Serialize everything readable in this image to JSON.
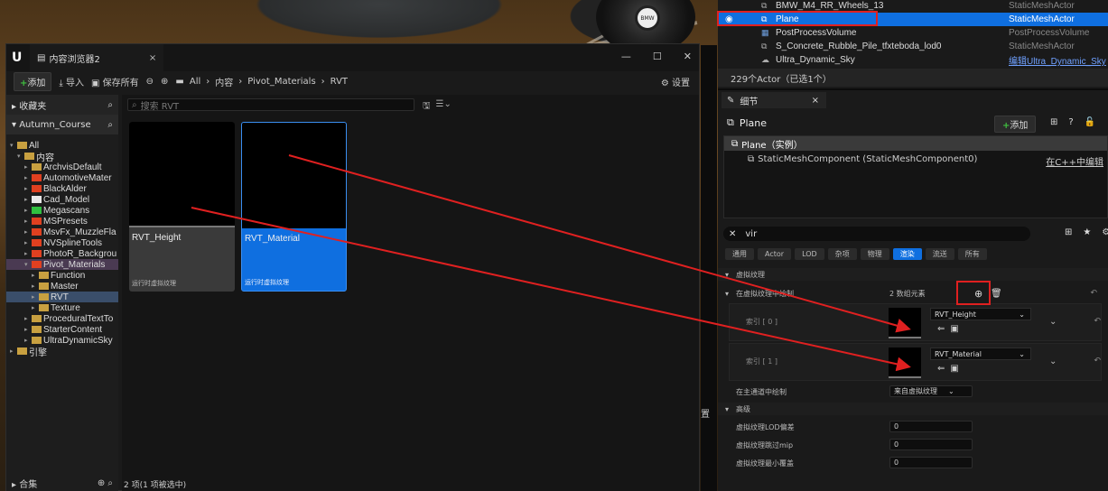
{
  "viewport": {
    "wheel_logo": "BMW"
  },
  "outliner": {
    "rows": [
      {
        "name": "BMW_M4_RR_Wheels_13",
        "type": "StaticMeshActor",
        "icon": "static-mesh-icon"
      },
      {
        "name": "Plane",
        "type": "StaticMeshActor",
        "icon": "static-mesh-icon",
        "selected": true
      },
      {
        "name": "PostProcessVolume",
        "type": "PostProcessVolume",
        "icon": "volume-icon"
      },
      {
        "name": "S_Concrete_Rubble_Pile_tfxteboda_lod0",
        "type": "StaticMeshActor",
        "icon": "static-mesh-icon"
      },
      {
        "name": "Ultra_Dynamic_Sky",
        "type": "编辑Ultra_Dynamic_Sky",
        "icon": "sky-icon"
      }
    ],
    "actor_count": "229个Actor（已选1个）"
  },
  "content_browser": {
    "tab_title": "内容浏览器2",
    "toolbar": {
      "add": "添加",
      "import": "导入",
      "save_all": "保存所有",
      "settings": "设置"
    },
    "breadcrumb": [
      "All",
      "内容",
      "Pivot_Materials",
      "RVT"
    ],
    "favorites": "收藏夹",
    "project": "Autumn_Course",
    "tree": [
      {
        "label": "All",
        "level": 0,
        "color": "#c8a040",
        "open": true
      },
      {
        "label": "内容",
        "level": 1,
        "color": "#c8a040",
        "open": true
      },
      {
        "label": "ArchvisDefault",
        "level": 2,
        "color": "#c8a040"
      },
      {
        "label": "AutomotiveMater",
        "level": 2,
        "color": "#e04020"
      },
      {
        "label": "BlackAlder",
        "level": 2,
        "color": "#e04020"
      },
      {
        "label": "Cad_Model",
        "level": 2,
        "color": "#e8e8e8"
      },
      {
        "label": "Megascans",
        "level": 2,
        "color": "#30c040"
      },
      {
        "label": "MSPresets",
        "level": 2,
        "color": "#e04020"
      },
      {
        "label": "MsvFx_MuzzleFla",
        "level": 2,
        "color": "#e04020"
      },
      {
        "label": "NVSplineTools",
        "level": 2,
        "color": "#e04020"
      },
      {
        "label": "PhotoR_Backgrou",
        "level": 2,
        "color": "#e04020"
      },
      {
        "label": "Pivot_Materials",
        "level": 2,
        "color": "#e04020",
        "open": true,
        "hl": true
      },
      {
        "label": "Function",
        "level": 3,
        "color": "#c8a040"
      },
      {
        "label": "Master",
        "level": 3,
        "color": "#c8a040"
      },
      {
        "label": "RVT",
        "level": 3,
        "color": "#c8a040",
        "sel": true
      },
      {
        "label": "Texture",
        "level": 3,
        "color": "#c8a040"
      },
      {
        "label": "ProceduralTextTo",
        "level": 2,
        "color": "#c8a040"
      },
      {
        "label": "StarterContent",
        "level": 2,
        "color": "#c8a040"
      },
      {
        "label": "UltraDynamicSky",
        "level": 2,
        "color": "#c8a040"
      },
      {
        "label": "引擎",
        "level": 0,
        "color": "#c8a040"
      }
    ],
    "collections": "合集",
    "search_placeholder": "搜索 RVT",
    "assets": [
      {
        "name": "RVT_Height",
        "type": "运行时虚拟纹理"
      },
      {
        "name": "RVT_Material",
        "type": "运行时虚拟纹理"
      }
    ],
    "status": "2 项(1 项被选中)"
  },
  "details": {
    "tab": "细节",
    "actor": "Plane",
    "add": "添加",
    "instance": "Plane（实例）",
    "component": "StaticMeshComponent (StaticMeshComponent0)",
    "edit_cpp": "在C++中编辑",
    "filter": "vir",
    "categories": [
      "通用",
      "Actor",
      "LOD",
      "杂项",
      "物理",
      "渲染",
      "流送",
      "所有"
    ],
    "active_category": "渲染",
    "virtual_texture": "虚拟纹理",
    "draw_in_vt": "在虚拟纹理中绘制",
    "array_count": "2 数组元素",
    "index0": "索引 [ 0 ]",
    "index1": "索引 [ 1 ]",
    "rvt0": "RVT_Height",
    "rvt1": "RVT_Material",
    "draw_main": "在主通道中绘制",
    "draw_main_value": "来自虚拟纹理",
    "advanced": "高级",
    "lod_bias": "虚拟纹理LOD偏差",
    "lod_bias_val": "0",
    "skip_mip": "虚拟纹理跳过mip",
    "skip_mip_val": "0",
    "min_cover": "虚拟纹理最小覆盖",
    "min_cover_val": "0"
  },
  "side_label": "置"
}
